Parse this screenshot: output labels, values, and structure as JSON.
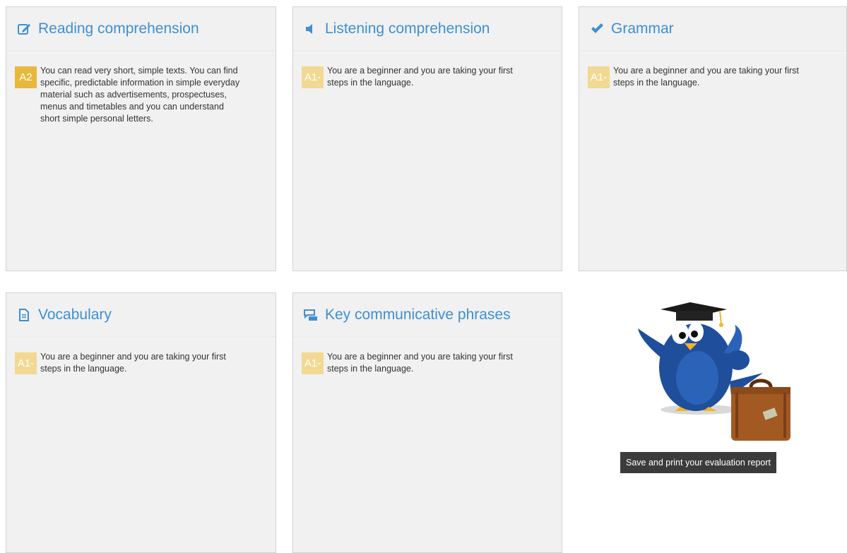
{
  "cards": [
    {
      "title": "Reading comprehension",
      "icon": "edit-icon",
      "level": "A2",
      "text": "You can read very short, simple texts. You can find specific, predictable information in simple everyday material such as advertisements, prospectuses, menus and timetables and you can understand short simple personal letters."
    },
    {
      "title": "Listening comprehension",
      "icon": "speaker-icon",
      "level": "A1-",
      "text": "You are a beginner and you are taking your first steps in the language."
    },
    {
      "title": "Grammar",
      "icon": "checkmark-icon",
      "level": "A1-",
      "text": "You are a beginner and you are taking your first steps in the language."
    },
    {
      "title": "Vocabulary",
      "icon": "document-icon",
      "level": "A1-",
      "text": "You are a beginner and you are taking your first steps in the language."
    },
    {
      "title": "Key communicative phrases",
      "icon": "chat-bubbles-icon",
      "level": "A1-",
      "text": "You are a beginner and you are taking your first steps in the language."
    }
  ],
  "report": {
    "label": "Save and print your evaluation report",
    "image": "graduate-bird-with-suitcase"
  },
  "colors": {
    "title": "#3f8fd2",
    "badge_strong": "#e8b83c",
    "badge_light": "#f2d993",
    "card_bg": "#f1f1f1",
    "tooltip_bg": "#3b3b3b"
  }
}
